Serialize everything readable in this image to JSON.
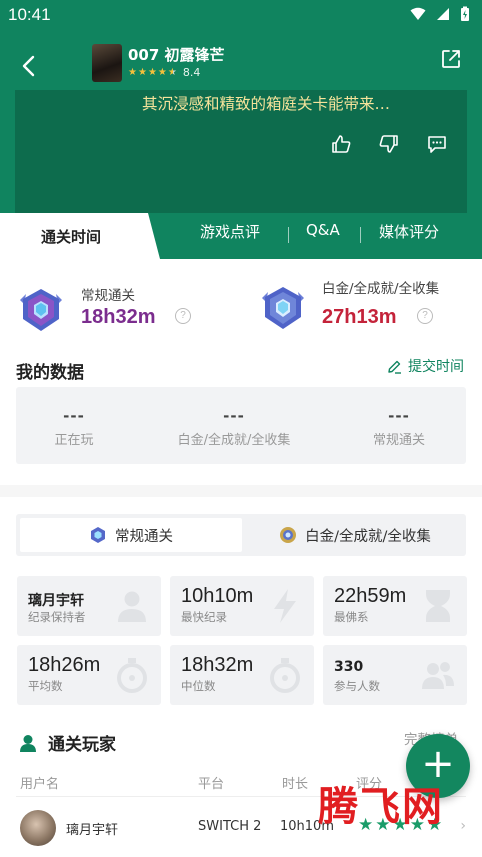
{
  "status_bar": {
    "time": "10:41"
  },
  "header": {
    "game_title": "007 初露锋芒",
    "rating_score": "8.4",
    "rating_stars": 4.5,
    "review_quote": "其沉浸感和精致的箱庭关卡能带来…"
  },
  "tabs": [
    {
      "label": "通关时间",
      "active": true
    },
    {
      "label": "游戏点评",
      "active": false
    },
    {
      "label": "Q&A",
      "active": false
    },
    {
      "label": "媒体评分",
      "active": false
    }
  ],
  "best_times": {
    "normal": {
      "label": "常规通关",
      "value": "18h32m",
      "color": "#7b2d8e"
    },
    "platinum": {
      "label": "白金/全成就/全收集",
      "value": "27h13m",
      "color": "#c4233a"
    }
  },
  "my_data": {
    "title": "我的数据",
    "submit_label": "提交时间",
    "items": [
      {
        "value": "---",
        "label": "正在玩"
      },
      {
        "value": "---",
        "label": "白金/全成就/全收集"
      },
      {
        "value": "---",
        "label": "常规通关"
      }
    ]
  },
  "mode_switch": {
    "active": "常规通关",
    "inactive": "白金/全成就/全收集"
  },
  "stats": [
    {
      "value": "璃月宇轩",
      "label": "纪录保持者",
      "icon": "user-icon"
    },
    {
      "value": "10h10m",
      "label": "最快纪录",
      "icon": "lightning-icon"
    },
    {
      "value": "22h59m",
      "label": "最佛系",
      "icon": "hourglass-icon"
    },
    {
      "value": "18h26m",
      "label": "平均数",
      "icon": "stopwatch-icon"
    },
    {
      "value": "18h32m",
      "label": "中位数",
      "icon": "stopwatch-icon"
    },
    {
      "value": "330",
      "label": "参与人数",
      "icon": "users-icon"
    }
  ],
  "players": {
    "title": "通关玩家",
    "full_list_label": "完整榜单",
    "columns": {
      "user": "用户名",
      "platform": "平台",
      "duration": "时长",
      "rating": "评分"
    },
    "rows": [
      {
        "name": "璃月宇轩",
        "platform": "SWITCH 2",
        "duration": "10h10m",
        "stars": 5
      }
    ]
  },
  "fab_label": "+",
  "watermark": "腾飞网",
  "colors": {
    "brand": "#10845f",
    "accent_purple": "#7b2d8e",
    "accent_red": "#c4233a",
    "star_gold": "#f3c03b"
  }
}
